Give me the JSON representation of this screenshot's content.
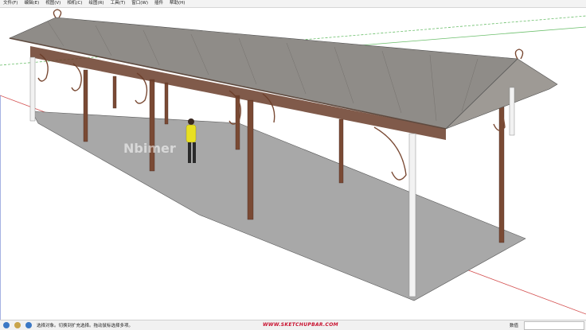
{
  "menu": [
    "文件(F)",
    "编辑(E)",
    "视图(V)",
    "相机(C)",
    "绘图(R)",
    "工具(T)",
    "窗口(W)",
    "插件",
    "帮助(H)"
  ],
  "colors": {
    "roof": "#8f8c88",
    "roof_edge": "#5e4a3f",
    "frame": "#7a4a34",
    "gutter": "#f2f2f2",
    "ground": "#a8a8a8",
    "figure_shirt": "#e8e022",
    "axis_green": "#6bbf6b",
    "axis_red": "#d45050",
    "axis_blue": "#6a7fd0"
  },
  "watermarks": [
    "Nbimer",
    "Nbimer"
  ],
  "status": {
    "icons": [
      "info-icon",
      "user-icon",
      "help-icon"
    ],
    "hint": "选择对象。切换到扩充选择。拖动鼠标选择多项。",
    "site": "WWW.SKETCHUPBAR.COM",
    "measurement_label": "数值",
    "measurement_value": ""
  }
}
